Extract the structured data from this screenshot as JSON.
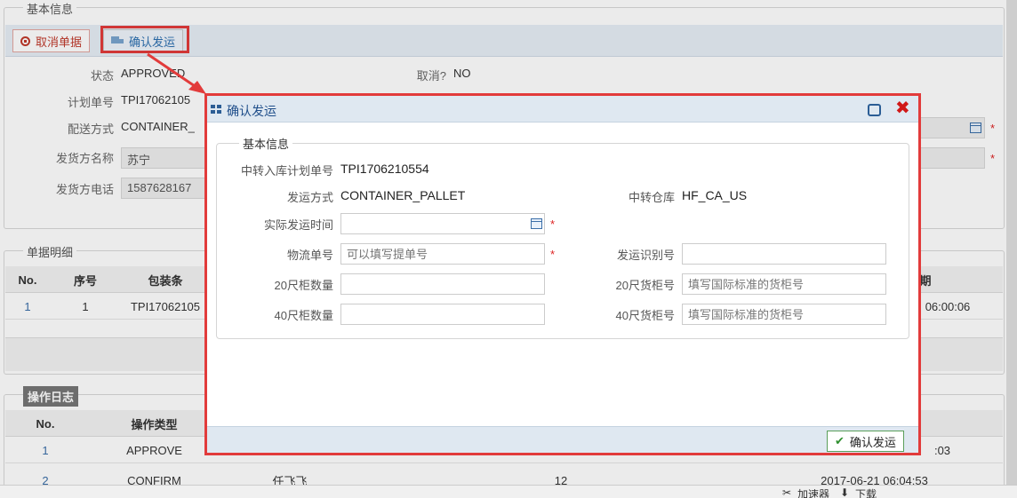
{
  "background": {
    "section_basic": "基本信息",
    "toolbar": {
      "cancel_label": "取消单据",
      "ship_label": "确认发运"
    },
    "fields": {
      "status_label": "状态",
      "status_value": "APPROVED",
      "cancelled_label": "取消?",
      "cancelled_value": "NO",
      "plan_no_label": "计划单号",
      "plan_no_value": "TPI17062105",
      "delivery_label": "配送方式",
      "delivery_value": "CONTAINER_",
      "shipper_name_label": "发货方名称",
      "shipper_name_value": "苏宁",
      "shipper_phone_label": "发货方电话",
      "shipper_phone_value": "1587628167"
    },
    "section_details": "单据明细",
    "details_headers": [
      "No.",
      "序号",
      "包装条"
    ],
    "details_row": [
      "1",
      "1",
      "TPI17062105"
    ],
    "details_right_header": "期",
    "details_right_cell": "06:00:06",
    "section_log": "操作日志",
    "log_headers": [
      "No.",
      "操作类型"
    ],
    "log_rows": [
      {
        "no": "1",
        "type": "APPROVE",
        "user": "",
        "count": "",
        "time": ":03"
      },
      {
        "no": "2",
        "type": "CONFIRM",
        "user": "任飞飞",
        "count": "12",
        "time": "2017-06-21 06:04:53"
      }
    ],
    "status_bar": {
      "accelerator": "加速器",
      "download": "下载"
    }
  },
  "dialog": {
    "title": "确认发运",
    "fieldset_label": "基本信息",
    "transit_plan_label": "中转入库计划单号",
    "transit_plan_value": "TPI1706210554",
    "ship_method_label": "发运方式",
    "ship_method_value": "CONTAINER_PALLET",
    "transit_wh_label": "中转仓库",
    "transit_wh_value": "HF_CA_US",
    "actual_time_label": "实际发运时间",
    "actual_time_value": "",
    "logistics_no_label": "物流单号",
    "logistics_no_placeholder": "可以填写提单号",
    "ship_id_label": "发运识别号",
    "ship_id_value": "",
    "qty20_label": "20尺柜数量",
    "qty20_value": "",
    "cno20_label": "20尺货柜号",
    "cno20_placeholder": "填写国际标准的货柜号",
    "qty40_label": "40尺柜数量",
    "qty40_value": "",
    "cno40_label": "40尺货柜号",
    "cno40_placeholder": "填写国际标准的货柜号",
    "confirm_label": "确认发运",
    "required_mark": "*"
  },
  "colors": {
    "highlight": "#e23b3b",
    "title_blue": "#1f4e8a",
    "header_bg": "#dfe8f1"
  }
}
